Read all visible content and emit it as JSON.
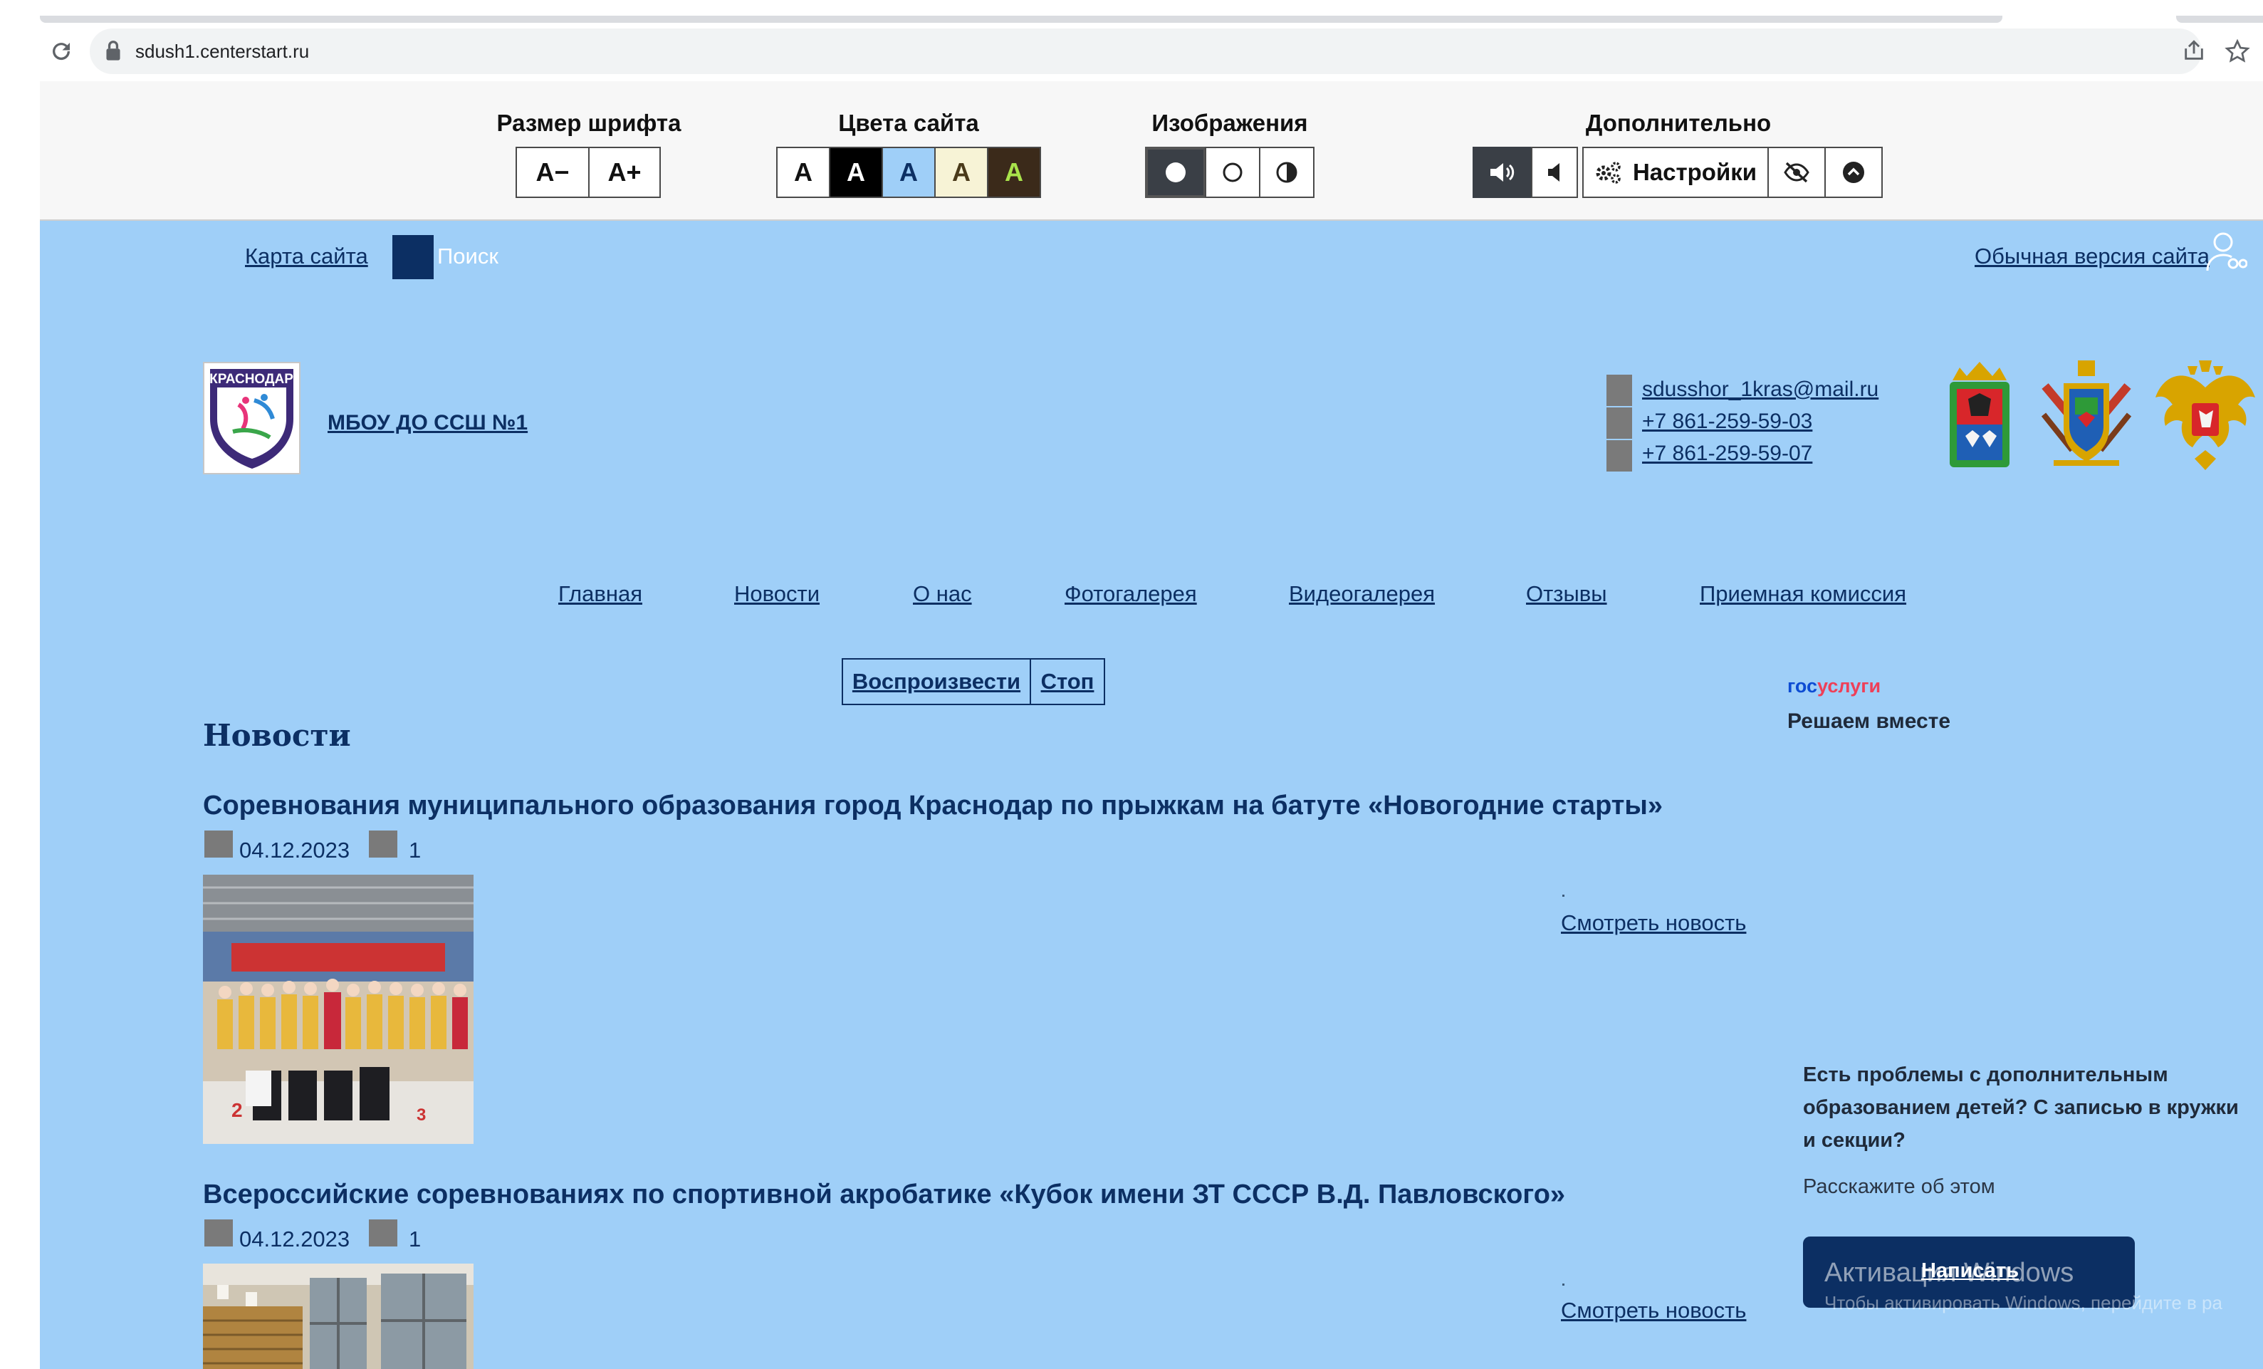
{
  "browser": {
    "url": "sdush1.centerstart.ru"
  },
  "accessibility_panel": {
    "font_size": {
      "title": "Размер шрифта",
      "decrease": "A−",
      "increase": "A+"
    },
    "colors": {
      "title": "Цвета сайта",
      "schemes": [
        {
          "label": "A",
          "bg": "#ffffff",
          "fg": "#000000"
        },
        {
          "label": "A",
          "bg": "#000000",
          "fg": "#ffffff"
        },
        {
          "label": "A",
          "bg": "#9fcff8",
          "fg": "#0c2f63"
        },
        {
          "label": "A",
          "bg": "#f7f3d6",
          "fg": "#4a3a1a"
        },
        {
          "label": "A",
          "bg": "#3b2a1a",
          "fg": "#a9e34b"
        }
      ]
    },
    "images": {
      "title": "Изображения"
    },
    "extra": {
      "title": "Дополнительно",
      "settings_label": "Настройки"
    }
  },
  "top_links": {
    "sitemap": "Карта сайта",
    "search": "Поиск",
    "normal_version": "Обычная версия сайта"
  },
  "header": {
    "logo_text": "КРАСНОДАР",
    "org_name": "МБОУ ДО ССШ №1",
    "email": "sdusshor_1kras@mail.ru",
    "phone1": "+7 861-259-59-03",
    "phone2": "+7 861-259-59-07"
  },
  "nav": {
    "items": [
      "Главная",
      "Новости",
      "О нас",
      "Фотогалерея",
      "Видеогалерея",
      "Отзывы",
      "Приемная комиссия"
    ]
  },
  "tts": {
    "play": "Воспроизвести",
    "stop": "Стоп"
  },
  "news": {
    "section_title": "Новости",
    "view_label": "Смотреть новость",
    "items": [
      {
        "title": "Соревнования муниципального образования город Краснодар по прыжкам на батуте «Новогодние старты»",
        "date": "04.12.2023",
        "views": "1"
      },
      {
        "title": "Всероссийские соревнованиях по спортивной акробатике «Кубок имени ЗТ СССР В.Д. Павловского»",
        "date": "04.12.2023",
        "views": "1"
      }
    ]
  },
  "gosuslugi": {
    "logo_part1": "гос",
    "logo_part2": "услуги",
    "tagline": "Решаем вместе",
    "question": "Есть проблемы с дополнительным образованием детей? С записью в кружки и секции?",
    "tell": "Расскажите об этом",
    "button": "Написать"
  },
  "windows_watermark": {
    "title": "Активация Windows",
    "subtitle": "Чтобы активировать Windows, перейдите в ра"
  }
}
